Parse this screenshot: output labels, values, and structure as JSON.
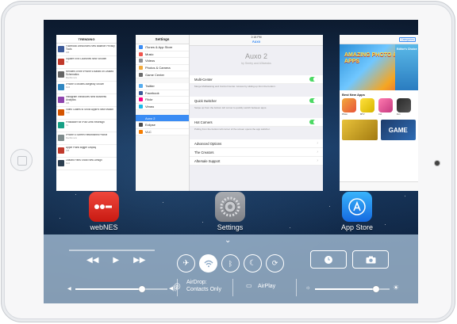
{
  "cards": {
    "trending": {
      "title": "TRENDING",
      "items": [
        {
          "text": "Facebook Announces New Balance Privacy Tools",
          "source": "iDB"
        },
        {
          "text": "Square Enix Launches New Shooter",
          "source": "TA"
        },
        {
          "text": "Renders of the iPhone 6 Based on Leaked Schematics",
          "source": "MacRumors"
        },
        {
          "text": "iPhone 6 Models Allegedly Shown",
          "source": "9to5"
        },
        {
          "text": "Instagram Introduces New Business Analytics",
          "source": "iDB"
        },
        {
          "text": "Video Claims to Show Apple's New iWatch",
          "source": "Cult"
        },
        {
          "text": "Pinstacker for iPad Gets Redesign",
          "source": "TA"
        },
        {
          "text": "iPhone 6 Screen Refurbished Photos",
          "source": "MacRumors"
        },
        {
          "text": "Apple Plans Bigger Display",
          "source": "iDB"
        },
        {
          "text": "Leaked Parts Show New Design",
          "source": "9to5"
        }
      ]
    },
    "settings": {
      "title": "Settings",
      "status_time": "2:18 PM",
      "nav_title": "Auxo",
      "sidebar": [
        "iTunes & App Store",
        "Music",
        "Videos",
        "Photos & Camera",
        "Game Center",
        "Twitter",
        "Facebook",
        "Flickr",
        "Vimeo",
        "Auxo 2",
        "Eclipse",
        "VLC"
      ],
      "hero_title": "Auxo 2",
      "hero_sub": "by Sentry and A3tweaks",
      "rows": [
        {
          "label": "Multi-Center",
          "type": "toggle"
        },
        {
          "label": "Quick Switcher",
          "type": "toggle"
        },
        {
          "label": "Hot Corners",
          "type": "toggle"
        },
        {
          "label": "Advanced Options",
          "type": "link"
        },
        {
          "label": "The Creators",
          "type": "link"
        },
        {
          "label": "Aftersale Support",
          "type": "link"
        }
      ],
      "notes": [
        "Merge Multitasking and Control Center. Access by sliding up from the bottom.",
        "Swipe up from the bottom left corner to quickly switch between apps.",
        "Pulling from the bottom left corner of the screen opens the app switcher."
      ]
    },
    "appstore": {
      "categories": "Categories",
      "banner_title": "AMAZING PHOTO & VIDEO APPS",
      "banner_right": "Editor's Choice",
      "section": "Best New Apps",
      "apps": [
        "Photo",
        "MTV",
        "Cut",
        "Fun"
      ],
      "feature": "GAME"
    }
  },
  "home_apps": [
    {
      "label": "webNES",
      "icon": "webnes-icon"
    },
    {
      "label": "Settings",
      "icon": "settings-gear-icon"
    },
    {
      "label": "App Store",
      "icon": "app-store-icon"
    }
  ],
  "control_center": {
    "media": {
      "prev": "◀◀",
      "play": "▶",
      "next": "▶▶"
    },
    "airdrop_label": "AirDrop:",
    "airdrop_value": "Contacts Only",
    "airplay_label": "AirPlay",
    "toggles": [
      "airplane-mode",
      "wifi",
      "bluetooth",
      "do-not-disturb",
      "rotation-lock"
    ],
    "volume": 0.72,
    "brightness": 0.82
  },
  "colors": {
    "webnes": "#e0291f",
    "appstore_blue": "#1d8ff0",
    "toggle_green": "#4cd964",
    "ios_blue": "#3a8cf4"
  }
}
